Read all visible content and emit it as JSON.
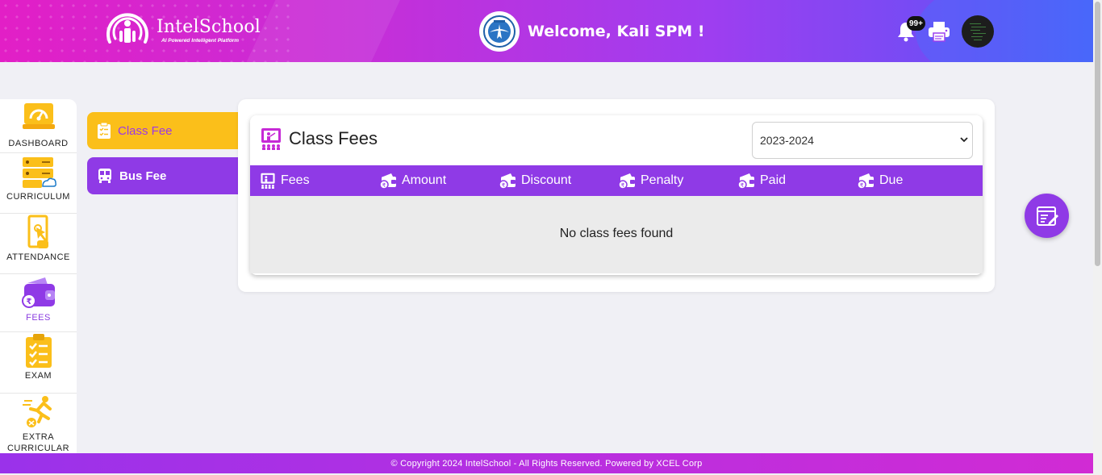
{
  "header": {
    "logo_name": "IntelSchool",
    "logo_tagline": "AI Powered Intelligent Platform",
    "welcome": "Welcome, Kali SPM !",
    "notification_count": "99+"
  },
  "sidebar": {
    "items": [
      {
        "label": "DASHBOARD",
        "icon": "dashboard-icon"
      },
      {
        "label": "CURRICULUM",
        "icon": "curriculum-icon"
      },
      {
        "label": "ATTENDANCE",
        "icon": "attendance-icon"
      },
      {
        "label": "FEES",
        "icon": "fees-wallet-icon",
        "active": true
      },
      {
        "label": "EXAM",
        "icon": "exam-clipboard-icon"
      },
      {
        "label": "EXTRA CURRICULAR",
        "icon": "extra-curricular-icon"
      }
    ]
  },
  "subtabs": {
    "class_fee": "Class Fee",
    "bus_fee": "Bus Fee"
  },
  "main": {
    "title": "Class Fees",
    "year_selected": "2023-2024",
    "columns": [
      "Fees",
      "Amount",
      "Discount",
      "Penalty",
      "Paid",
      "Due"
    ],
    "empty_message": "No class fees found"
  },
  "footer": {
    "text": "© Copyright 2024 IntelSchool - All Rights Reserved. Powered by XCEL Corp"
  },
  "colors": {
    "accent_purple": "#8f3ae6",
    "accent_yellow": "#fbbf1a",
    "header_pink": "#e21fc6"
  }
}
